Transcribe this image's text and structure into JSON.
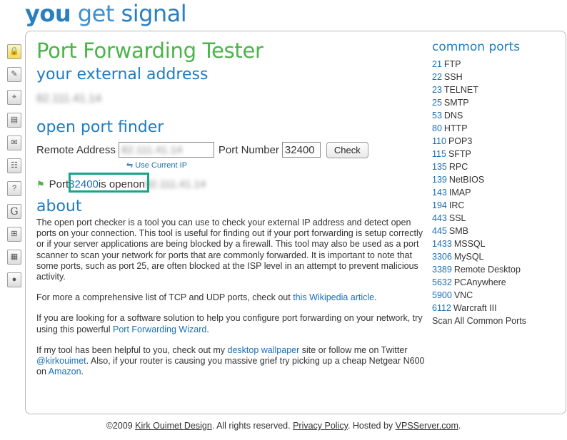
{
  "logo": {
    "you": "you",
    "get": " get",
    "signal": " signal"
  },
  "toolbar": {
    "icons": [
      "lock-icon",
      "text-icon",
      "location-icon",
      "printer-icon",
      "email-icon",
      "network-icon",
      "help-icon",
      "google-icon",
      "windows-icon",
      "document-icon",
      "globe-icon"
    ]
  },
  "main": {
    "title": "Port Forwarding Tester",
    "external_heading": "your external address",
    "external_ip": "82.111.41.14",
    "finder_heading": "open port finder",
    "remote_label": "Remote Address",
    "remote_value": "82.111.41.14",
    "port_label": "Port Number",
    "port_value": "32400",
    "check_label": "Check",
    "use_ip_label": "Use Current IP",
    "result": {
      "prefix": "Port ",
      "port": "32400",
      "status": " is open",
      "on": " on ",
      "ip": "82.111.41.14"
    },
    "about_heading": "about",
    "about_p1": "The open port checker is a tool you can use to check your external IP address and detect open ports on your connection. This tool is useful for finding out if your port forwarding is setup correctly or if your server applications are being blocked by a firewall. This tool may also be used as a port scanner to scan your network for ports that are commonly forwarded. It is important to note that some ports, such as port 25, are often blocked at the ISP level in an attempt to prevent malicious activity.",
    "about_p2_text": "For more a comprehensive list of TCP and UDP ports, check out ",
    "about_p2_link": "this Wikipedia article",
    "about_p2_end": ".",
    "about_p3_text": "If you are looking for a software solution to help you configure port forwarding on your network, try using this powerful ",
    "about_p3_link": "Port Forwarding Wizard",
    "about_p3_end": ".",
    "about_p4_a": "If my tool has been helpful to you, check out my ",
    "about_p4_link1": "desktop wallpaper",
    "about_p4_b": " site or follow me on Twitter ",
    "about_p4_link2": "@kirkouimet",
    "about_p4_c": ". Also, if your router is causing you massive grief try picking up a cheap Netgear N600 on ",
    "about_p4_link3": "Amazon",
    "about_p4_end": "."
  },
  "ports": {
    "heading": "common ports",
    "items": [
      {
        "num": "21",
        "name": "FTP"
      },
      {
        "num": "22",
        "name": "SSH"
      },
      {
        "num": "23",
        "name": "TELNET"
      },
      {
        "num": "25",
        "name": "SMTP"
      },
      {
        "num": "53",
        "name": "DNS"
      },
      {
        "num": "80",
        "name": "HTTP"
      },
      {
        "num": "110",
        "name": "POP3"
      },
      {
        "num": "115",
        "name": "SFTP"
      },
      {
        "num": "135",
        "name": "RPC"
      },
      {
        "num": "139",
        "name": "NetBIOS"
      },
      {
        "num": "143",
        "name": "IMAP"
      },
      {
        "num": "194",
        "name": "IRC"
      },
      {
        "num": "443",
        "name": "SSL"
      },
      {
        "num": "445",
        "name": "SMB"
      },
      {
        "num": "1433",
        "name": "MSSQL"
      },
      {
        "num": "3306",
        "name": "MySQL"
      },
      {
        "num": "3389",
        "name": "Remote Desktop"
      },
      {
        "num": "5632",
        "name": "PCAnywhere"
      },
      {
        "num": "5900",
        "name": "VNC"
      },
      {
        "num": "6112",
        "name": "Warcraft III"
      }
    ],
    "scan_all": "Scan All Common Ports"
  },
  "footer": {
    "copy": "©2009 ",
    "author": "Kirk Ouimet Design",
    "rights": ". All rights reserved. ",
    "privacy": "Privacy Policy",
    "hosted": ". Hosted by ",
    "host": "VPSServer.com",
    "end": "."
  }
}
